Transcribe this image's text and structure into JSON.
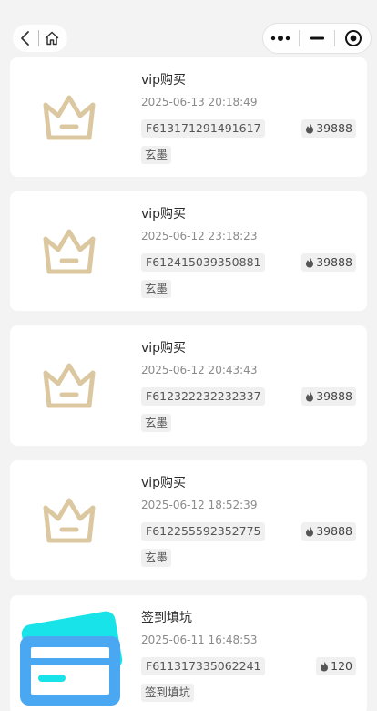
{
  "colors": {
    "crown": "#dcc8a0",
    "card_bg": "#ffffff",
    "page_bg": "#f3f3f3",
    "card_icon_back": "#17e3e8",
    "card_icon_front": "#4aa7f2"
  },
  "nav": {
    "back_icon": "chevron-left-icon",
    "home_icon": "home-icon",
    "more_icon": "more-dots-icon",
    "minimize_icon": "minimize-icon",
    "close_icon": "target-close-icon"
  },
  "records": [
    {
      "icon": "crown-icon",
      "title": "vip购买",
      "time": "2025-06-13 20:18:49",
      "order_no": "F613171291491617",
      "points": "39888",
      "tag": "玄墨"
    },
    {
      "icon": "crown-icon",
      "title": "vip购买",
      "time": "2025-06-12 23:18:23",
      "order_no": "F612415039350881",
      "points": "39888",
      "tag": "玄墨"
    },
    {
      "icon": "crown-icon",
      "title": "vip购买",
      "time": "2025-06-12 20:43:43",
      "order_no": "F612322232232337",
      "points": "39888",
      "tag": "玄墨"
    },
    {
      "icon": "crown-icon",
      "title": "vip购买",
      "time": "2025-06-12 18:52:39",
      "order_no": "F612255592352775",
      "points": "39888",
      "tag": "玄墨"
    },
    {
      "icon": "credit-card-icon",
      "title": "签到填坑",
      "time": "2025-06-11 16:48:53",
      "order_no": "F611317335062241",
      "points": "120",
      "tag": "签到填坑"
    }
  ]
}
